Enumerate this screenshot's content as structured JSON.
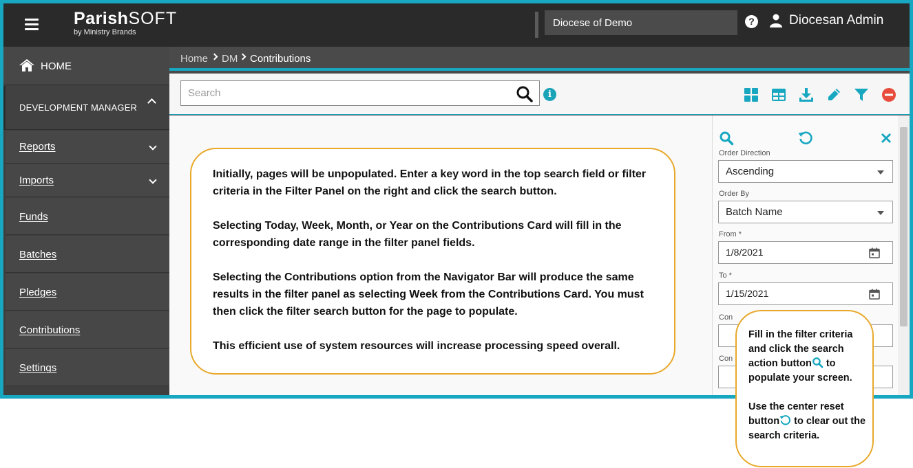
{
  "header": {
    "logo_main": "Parish",
    "logo_soft": "SOFT",
    "logo_sub": "by Ministry Brands",
    "diocese": "Diocese of Demo",
    "help": "?",
    "user_name": "Diocesan Admin"
  },
  "sidebar": {
    "home": "HOME",
    "section": "DEVELOPMENT MANAGER",
    "items": [
      {
        "label": "Reports",
        "has_chevron": true
      },
      {
        "label": "Imports",
        "has_chevron": true
      },
      {
        "label": "Funds",
        "has_chevron": false
      },
      {
        "label": "Batches",
        "has_chevron": false
      },
      {
        "label": "Pledges",
        "has_chevron": false
      },
      {
        "label": "Contributions",
        "has_chevron": false
      },
      {
        "label": "Settings",
        "has_chevron": false
      }
    ]
  },
  "breadcrumb": [
    "Home",
    "DM",
    "Contributions"
  ],
  "search": {
    "placeholder": "Search",
    "value": ""
  },
  "toolbar_icons": [
    "card-view-icon",
    "table-view-icon",
    "download-icon",
    "edit-icon",
    "filter-icon",
    "remove-icon"
  ],
  "colors": {
    "accent": "#17a7c1",
    "callout_border": "#e8a82a",
    "danger": "#e74c3c",
    "header_bg": "#2a2a2a"
  },
  "main_callout": {
    "p1": "Initially, pages will be unpopulated. Enter a key word in the top search field or filter criteria in the Filter Panel on the right and click the search button.",
    "p2": "Selecting Today, Week, Month, or Year on the Contributions Card will fill in the corresponding date range in the filter panel fields.",
    "p3": "Selecting the Contributions option from the Navigator Bar will produce the same results in the filter panel as selecting Week from the Contributions Card. You must then click the filter search button for the page to populate.",
    "p4": "This efficient use of system resources will increase processing speed overall."
  },
  "filter_panel": {
    "order_direction_label": "Order Direction",
    "order_direction_value": "Ascending",
    "order_by_label": "Order By",
    "order_by_value": "Batch Name",
    "from_label": "From *",
    "from_value": "1/8/2021",
    "to_label": "To *",
    "to_value": "1/15/2021",
    "con_label_1": "Con",
    "con_label_2": "Con"
  },
  "side_callout": {
    "p1_a": "Fill in the filter criteria and click the search action button",
    "p1_b": " to populate your screen.",
    "p2_a": "Use the center reset button",
    "p2_b": " to clear out the search criteria."
  }
}
